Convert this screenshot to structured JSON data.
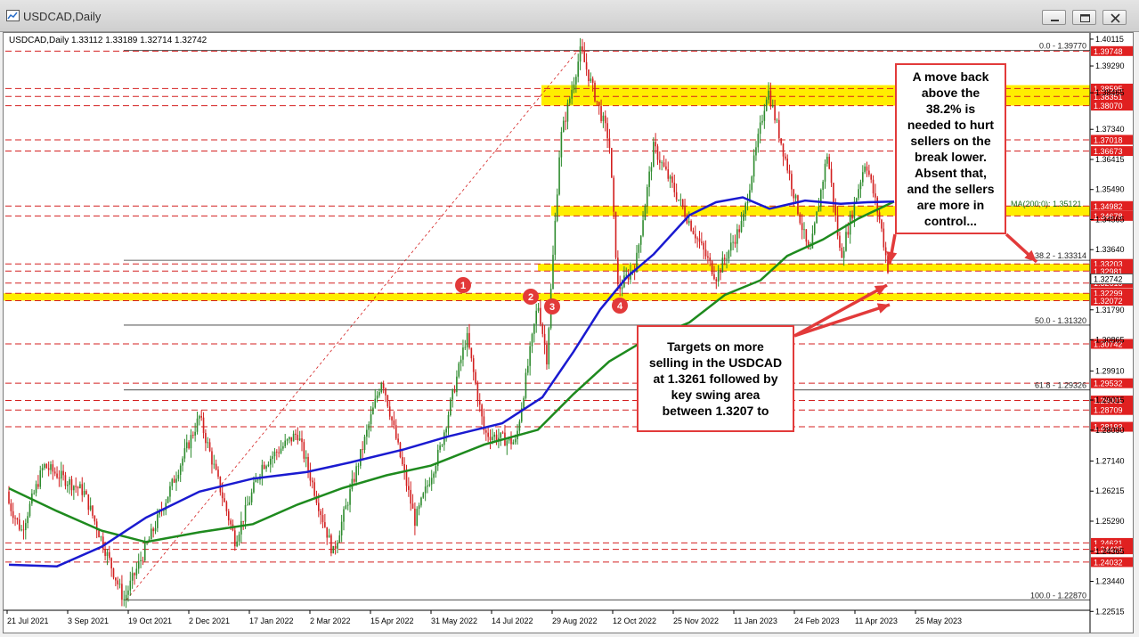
{
  "window": {
    "title": "USDCAD,Daily",
    "buttons": [
      "minimize",
      "restore",
      "close"
    ]
  },
  "chart_data": {
    "type": "candlestick",
    "symbol_header": "USDCAD,Daily  1.33112 1.33189 1.32714 1.32742",
    "y_range": [
      1.2255,
      1.4025
    ],
    "y_ticks": [
      "1.40115",
      "1.39290",
      "1.38465",
      "1.37340",
      "1.36415",
      "1.35490",
      "1.34565",
      "1.33640",
      "1.32715",
      "1.31790",
      "1.30865",
      "1.29910",
      "1.29015",
      "1.28090",
      "1.27140",
      "1.26215",
      "1.25290",
      "1.24365",
      "1.23440",
      "1.22515"
    ],
    "x_ticks": [
      "21 Jul 2021",
      "3 Sep 2021",
      "19 Oct 2021",
      "2 Dec 2021",
      "17 Jan 2022",
      "2 Mar 2022",
      "15 Apr 2022",
      "31 May 2022",
      "14 Jul 2022",
      "29 Aug 2022",
      "12 Oct 2022",
      "25 Nov 2022",
      "11 Jan 2023",
      "24 Feb 2023",
      "11 Apr 2023",
      "25 May 2023"
    ],
    "levels": [
      {
        "price": 1.39748,
        "label": "1.39748",
        "kind": "red"
      },
      {
        "price": 1.38595,
        "label": "1.38595",
        "kind": "red"
      },
      {
        "price": 1.38351,
        "label": "1.38351",
        "kind": "red"
      },
      {
        "price": 1.3807,
        "label": "1.38070",
        "kind": "red"
      },
      {
        "price": 1.37018,
        "label": "1.37018",
        "kind": "red"
      },
      {
        "price": 1.36673,
        "label": "1.36673",
        "kind": "red"
      },
      {
        "price": 1.34982,
        "label": "1.34982",
        "kind": "red"
      },
      {
        "price": 1.34678,
        "label": "1.34678",
        "kind": "red"
      },
      {
        "price": 1.33203,
        "label": "1.33203",
        "kind": "red"
      },
      {
        "price": 1.32981,
        "label": "1.32981",
        "kind": "red"
      },
      {
        "price": 1.32613,
        "label": "1.32613",
        "kind": "red"
      },
      {
        "price": 1.32299,
        "label": "1.32299",
        "kind": "red"
      },
      {
        "price": 1.32072,
        "label": "1.32072",
        "kind": "red"
      },
      {
        "price": 1.30742,
        "label": "1.30742",
        "kind": "red"
      },
      {
        "price": 1.29532,
        "label": "1.29532",
        "kind": "red"
      },
      {
        "price": 1.29001,
        "label": "1.29001",
        "kind": "red"
      },
      {
        "price": 1.28709,
        "label": "1.28709",
        "kind": "red"
      },
      {
        "price": 1.28193,
        "label": "1.28193",
        "kind": "red"
      },
      {
        "price": 1.24621,
        "label": "1.24621",
        "kind": "red"
      },
      {
        "price": 1.24425,
        "label": "1.24425",
        "kind": "red"
      },
      {
        "price": 1.24032,
        "label": "1.24032",
        "kind": "red"
      }
    ],
    "fib_levels": [
      {
        "price": 1.3977,
        "label": "0.0 - 1.39770"
      },
      {
        "price": 1.33314,
        "label": "38.2 - 1.33314"
      },
      {
        "price": 1.3132,
        "label": "50.0 - 1.31320"
      },
      {
        "price": 1.29326,
        "label": "61.8 - 1.29326"
      },
      {
        "price": 1.2287,
        "label": "100.0 - 1.22870"
      }
    ],
    "ma_label": "MA(200;0): 1.35121",
    "ma_value": 1.35121,
    "current_price": 1.32742,
    "yellow_bands": [
      {
        "from": 1.3807,
        "to": 1.387
      },
      {
        "from": 1.34678,
        "to": 1.34982
      },
      {
        "from": 1.32981,
        "to": 1.33203
      },
      {
        "from": 1.32072,
        "to": 1.32299
      }
    ],
    "markers": [
      "1",
      "2",
      "3",
      "4"
    ],
    "annotations": {
      "top": [
        "A move back",
        "above the",
        "38.2% is",
        "needed to hurt",
        "sellers on the",
        "break lower.",
        "Absent that,",
        "and the sellers",
        "are more in",
        "control..."
      ],
      "bottom": [
        "Targets on more",
        "selling in the USDCAD",
        "at 1.3261 followed by",
        "key swing area",
        "between 1.3207 to"
      ]
    },
    "colors": {
      "bull": "#2e8b2e",
      "bear": "#d22020",
      "ma_blue": "#1a1ad0",
      "ma_green": "#1e8a1e",
      "band": "#ffee00",
      "level": "#d42020",
      "level_label_bg": "#e02020"
    }
  }
}
